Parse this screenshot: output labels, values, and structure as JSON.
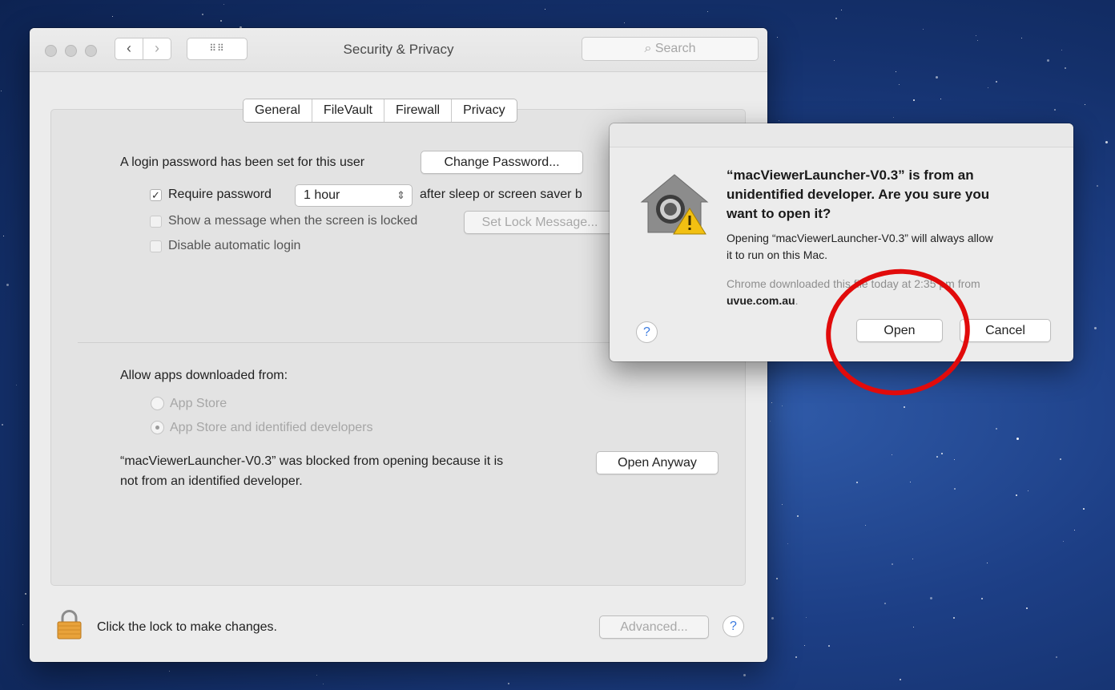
{
  "window": {
    "title": "Security & Privacy",
    "search_placeholder": "Search",
    "tabs": [
      "General",
      "FileVault",
      "Firewall",
      "Privacy"
    ],
    "selected_tab": "General"
  },
  "general": {
    "login_text": "A login password has been set for this user",
    "change_password": "Change Password...",
    "require_password_label": "Require password",
    "require_password_value": "1 hour",
    "after_sleep_text": "after sleep or screen saver b",
    "show_message_label": "Show a message when the screen is locked",
    "set_lock_message": "Set Lock Message...",
    "disable_login_label": "Disable automatic login",
    "allow_apps_label": "Allow apps downloaded from:",
    "radio_app_store": "App Store",
    "radio_identified": "App Store and identified developers",
    "blocked_text_line1": "“macViewerLauncher-V0.3” was blocked from opening because it is",
    "blocked_text_line2": "not from an identified developer.",
    "open_anyway": "Open Anyway"
  },
  "footer": {
    "lock_text": "Click the lock to make changes.",
    "advanced": "Advanced...",
    "help": "?"
  },
  "dialog": {
    "heading_line1": "“macViewerLauncher-V0.3” is from an",
    "heading_line2": "unidentified developer. Are you sure you",
    "heading_line3": "want to open it?",
    "body_line1": "Opening “macViewerLauncher-V0.3” will always allow",
    "body_line2": "it to run on this Mac.",
    "source_line1": "Chrome downloaded this file today at 2:35 pm from",
    "source_domain": "uvue.com.au",
    "source_period": ".",
    "help": "?",
    "open": "Open",
    "cancel": "Cancel"
  },
  "colors": {
    "highlight_circle": "#e10b0b",
    "help_accent": "#3b7be0",
    "desktop": "#1d3f86"
  }
}
